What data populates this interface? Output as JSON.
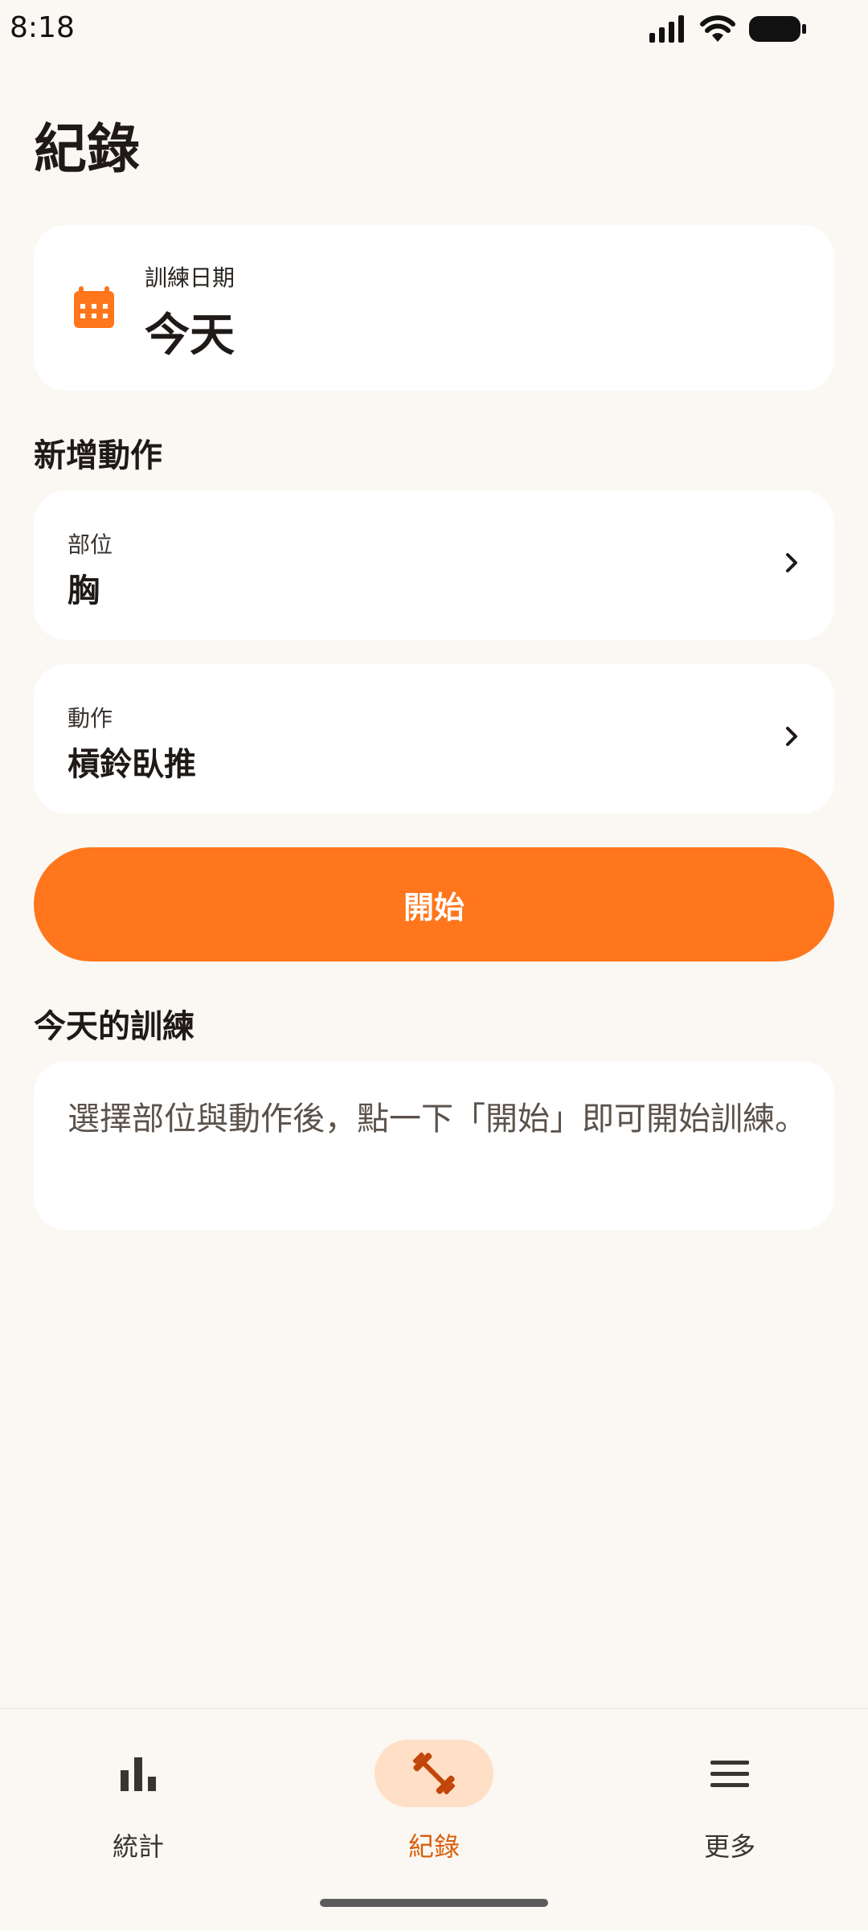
{
  "status_bar": {
    "time": "8:18"
  },
  "page": {
    "title": "紀錄"
  },
  "date_card": {
    "label": "訓練日期",
    "value": "今天",
    "icon": "calendar-icon"
  },
  "add_section": {
    "title": "新增動作",
    "body_part": {
      "label": "部位",
      "value": "胸"
    },
    "exercise": {
      "label": "動作",
      "value": "槓鈴臥推"
    },
    "start_label": "開始"
  },
  "today_section": {
    "title": "今天的訓練",
    "empty_text": "選擇部位與動作後，點一下「開始」即可開始訓練。"
  },
  "nav": {
    "items": [
      {
        "label": "統計",
        "icon": "bar-chart-icon"
      },
      {
        "label": "紀錄",
        "icon": "dumbbell-icon"
      },
      {
        "label": "更多",
        "icon": "menu-icon"
      }
    ],
    "selected": "紀錄"
  },
  "colors": {
    "accent": "#FF761C",
    "accent_text": "#D9600F",
    "accent_soft": "#FFE0C7",
    "background": "#FBF7F3"
  }
}
